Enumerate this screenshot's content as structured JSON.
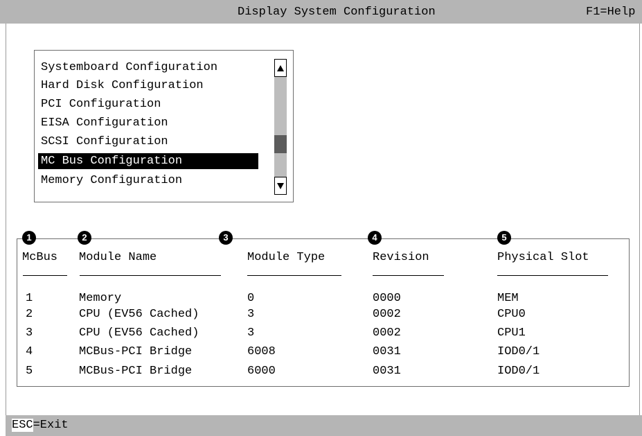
{
  "title_bar": {
    "title": "Display System Configuration",
    "help": "F1=Help"
  },
  "menu": {
    "items": [
      "Systemboard Configuration",
      "Hard Disk Configuration",
      "PCI Configuration",
      "EISA Configuration",
      "SCSI Configuration",
      "MC Bus Configuration",
      "Memory Configuration"
    ],
    "selected": "MC Bus Configuration"
  },
  "table": {
    "callouts": [
      "1",
      "2",
      "3",
      "4",
      "5"
    ],
    "headers": [
      "McBus",
      "Module Name",
      "Module Type",
      "Revision",
      "Physical Slot"
    ],
    "rows": [
      [
        "1",
        "Memory",
        "0",
        "0000",
        "MEM"
      ],
      [
        "2",
        "CPU (EV56 Cached)",
        "3",
        "0002",
        "CPU0"
      ],
      [
        "3",
        "CPU (EV56 Cached)",
        "3",
        "0002",
        "CPU1"
      ],
      [
        "4",
        "MCBus-PCI Bridge",
        "6008",
        "0031",
        "IOD0/1"
      ],
      [
        "5",
        "MCBus-PCI Bridge",
        "6000",
        "0031",
        "IOD0/1"
      ]
    ]
  },
  "status_bar": {
    "key": "ESC",
    "action": "=Exit"
  },
  "icons": {
    "scroll_up": "scroll-up-arrow-icon",
    "scroll_down": "scroll-down-arrow-icon"
  }
}
